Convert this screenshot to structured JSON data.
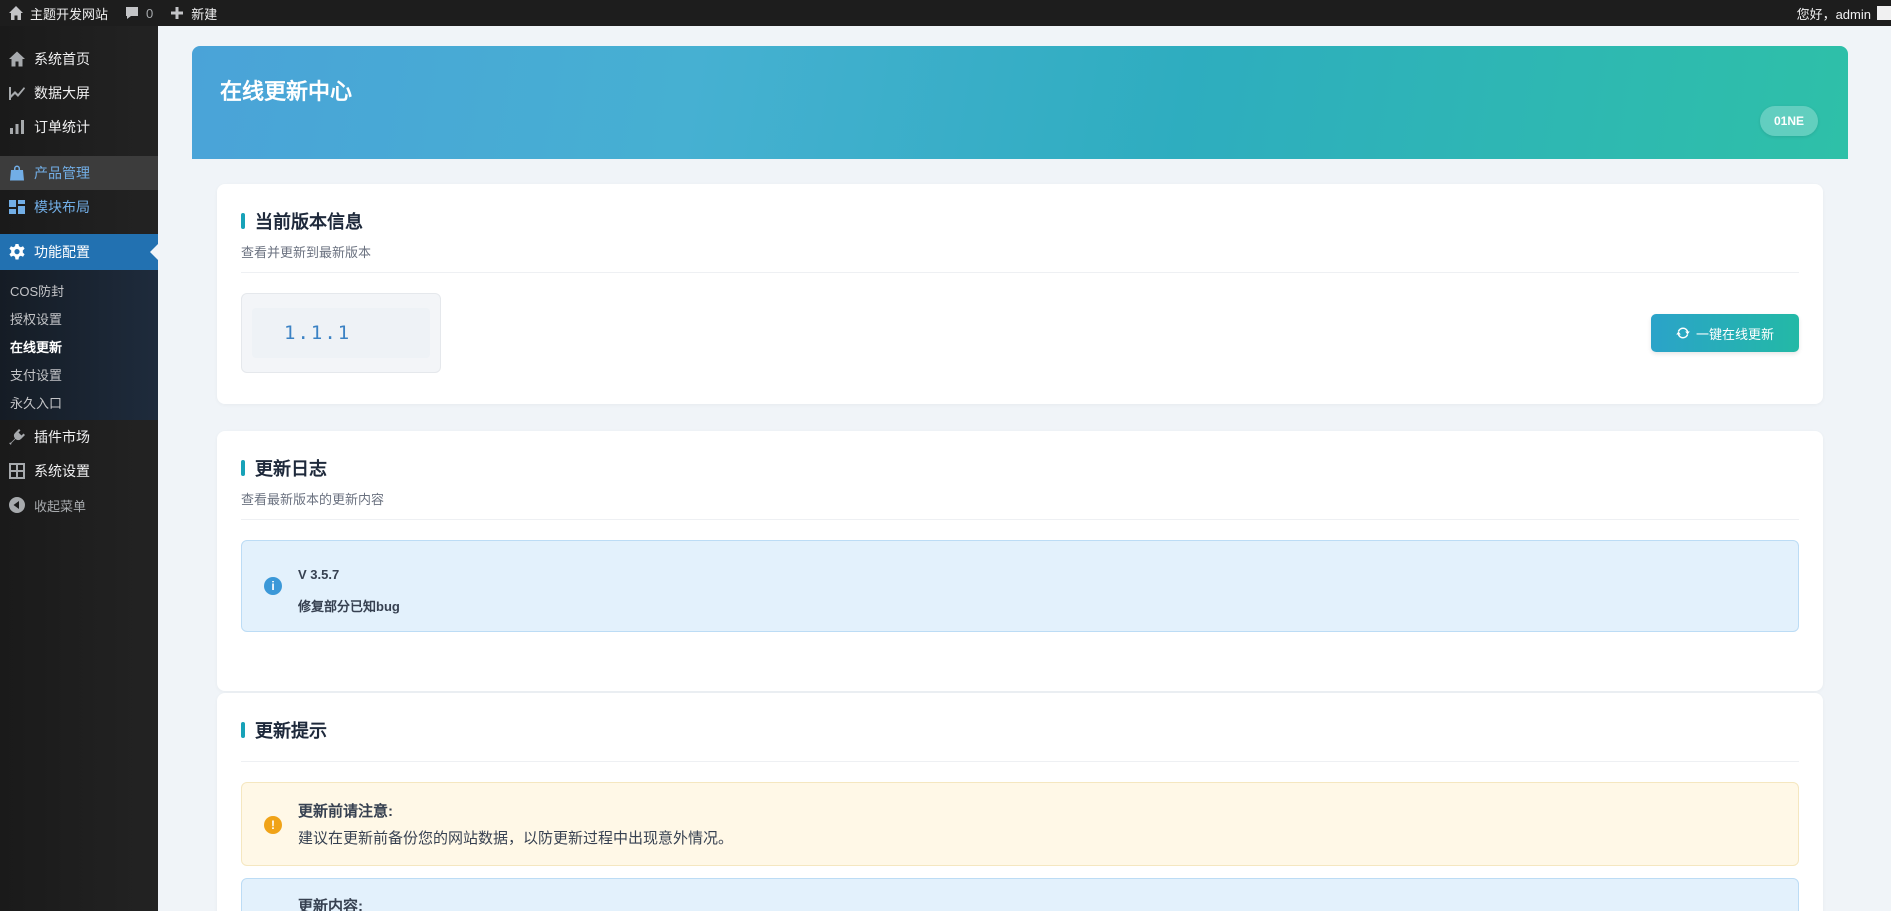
{
  "adminbar": {
    "site_name": "主题开发网站",
    "comments_count": "0",
    "new_label": "新建",
    "greeting": "您好，admin"
  },
  "sidebar": {
    "items": [
      {
        "label": "系统首页",
        "icon": "home-icon"
      },
      {
        "label": "数据大屏",
        "icon": "chart-area-icon"
      },
      {
        "label": "订单统计",
        "icon": "bar-chart-icon"
      },
      {
        "label": "产品管理",
        "icon": "shopping-bag-icon"
      },
      {
        "label": "模块布局",
        "icon": "layout-icon"
      },
      {
        "label": "功能配置",
        "icon": "gear-icon"
      }
    ],
    "submenu": [
      "COS防封",
      "授权设置",
      "在线更新",
      "支付设置",
      "永久入口"
    ],
    "lower_items": [
      {
        "label": "插件市场",
        "icon": "plugin-icon"
      },
      {
        "label": "系统设置",
        "icon": "settings-grid-icon"
      },
      {
        "label": "收起菜单",
        "icon": "collapse-icon"
      }
    ]
  },
  "hero": {
    "title": "在线更新中心",
    "badge": "01NE"
  },
  "version_card": {
    "title": "当前版本信息",
    "subtitle": "查看并更新到最新版本",
    "version": "1.1.1",
    "update_button": "一键在线更新"
  },
  "changelog_card": {
    "title": "更新日志",
    "subtitle": "查看最新版本的更新内容",
    "version": "V 3.5.7",
    "content": "修复部分已知bug"
  },
  "tips_card": {
    "title": "更新提示",
    "warn_title": "更新前请注意:",
    "warn_text": "建议在更新前备份您的网站数据，以防更新过程中出现意外情况。",
    "info_title": "更新内容:"
  },
  "colors": {
    "accent": "#2271b1",
    "hero_start": "#4aa3d8",
    "hero_end": "#2ec0a8",
    "title_bar": "#17a2b8"
  }
}
